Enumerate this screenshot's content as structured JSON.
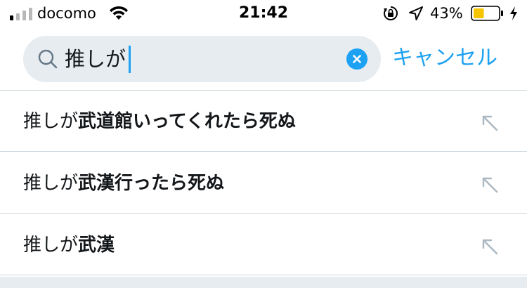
{
  "status_bar": {
    "carrier": "docomo",
    "time": "21:42",
    "battery_percent": "43%",
    "battery_level": 0.43,
    "signal_bars_active": 1,
    "signal_bars_total": 4
  },
  "search": {
    "query": "推しが",
    "clear_icon": "clear-icon",
    "cancel_label": "キャンセル",
    "accent_color": "#1da1f2"
  },
  "suggestions": [
    {
      "prefix": "推しが",
      "completion": "武道館いってくれたら死ぬ"
    },
    {
      "prefix": "推しが",
      "completion": "武漢行ったら死ぬ"
    },
    {
      "prefix": "推しが",
      "completion": "武漢"
    }
  ]
}
